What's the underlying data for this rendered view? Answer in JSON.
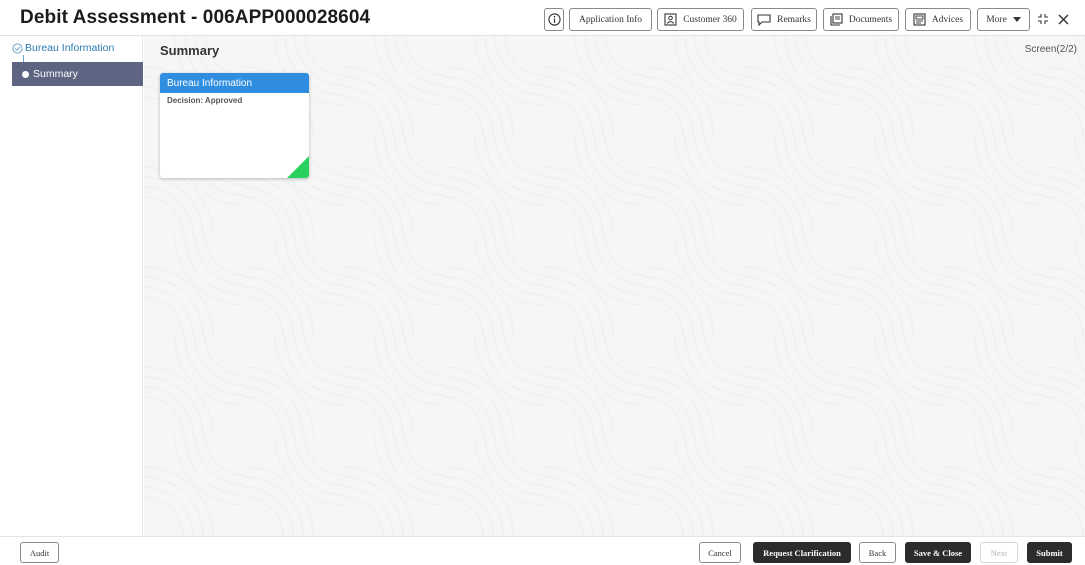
{
  "header": {
    "title": "Debit Assessment - 006APP000028604",
    "info_icon": "info-icon",
    "buttons": {
      "application_info": "Application Info",
      "customer_360": "Customer 360",
      "remarks": "Remarks",
      "documents": "Documents",
      "advices": "Advices",
      "more": "More"
    },
    "icons": {
      "customer_360": "person-card-icon",
      "remarks": "chat-bubble-icon",
      "documents": "documents-icon",
      "advices": "advices-icon",
      "more": "caret-down-icon",
      "collapse": "collapse-icon",
      "close": "close-icon"
    }
  },
  "sidebar": {
    "items": [
      {
        "label": "Bureau Information",
        "state": "completed",
        "icon": "check-circle-icon"
      },
      {
        "label": "Summary",
        "state": "active",
        "icon": "dot-icon"
      }
    ]
  },
  "main": {
    "title": "Summary",
    "screen_indicator": "Screen(2/2)",
    "cards": [
      {
        "title": "Bureau Information",
        "decision": "Decision: Approved",
        "status_color": "#29d15f"
      }
    ]
  },
  "footer": {
    "audit": "Audit",
    "cancel": "Cancel",
    "request_clarification": "Request Clarification",
    "back": "Back",
    "save_close": "Save & Close",
    "next": "Next",
    "submit": "Submit"
  },
  "colors": {
    "card_header": "#2f8ee0",
    "active_step": "#5d6582",
    "completed_step": "#2b7bb1",
    "primary_button": "#2c2c2c"
  }
}
